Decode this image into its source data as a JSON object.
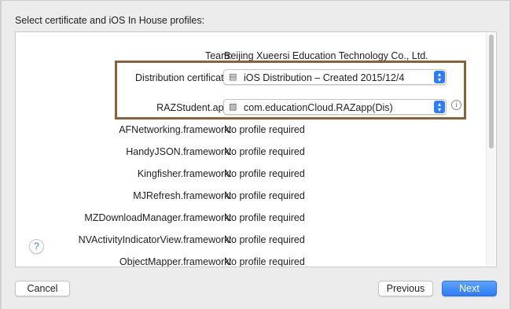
{
  "dialog": {
    "header": "Select certificate and iOS In House profiles:"
  },
  "rows": [
    {
      "label": "Team:",
      "value": "Beijing Xueersi Education Technology Co., Ltd."
    },
    {
      "label": "Distribution certificate:",
      "value": "iOS Distribution – Created 2015/12/4",
      "icon": "certificate-icon"
    },
    {
      "label": "RAZStudent.app:",
      "value": "com.educationCloud.RAZapp(Dis)",
      "icon": "profile-icon"
    },
    {
      "label": "AFNetworking.framework:",
      "value": "No profile required"
    },
    {
      "label": "HandyJSON.framework:",
      "value": "No profile required"
    },
    {
      "label": "Kingfisher.framework:",
      "value": "No profile required"
    },
    {
      "label": "MJRefresh.framework:",
      "value": "No profile required"
    },
    {
      "label": "MZDownloadManager.framework:",
      "value": "No profile required"
    },
    {
      "label": "NVActivityIndicatorView.framework:",
      "value": "No profile required"
    },
    {
      "label": "ObjectMapper.framework:",
      "value": "No profile required"
    }
  ],
  "icons": {
    "info": "i",
    "help": "?",
    "stepper_up": "▴",
    "stepper_down": "▾",
    "certificate": "▤",
    "profile": "▧"
  },
  "buttons": {
    "cancel": "Cancel",
    "previous": "Previous",
    "next": "Next"
  },
  "colors": {
    "highlight": "#8b6237",
    "accent": "#2e7cf6"
  }
}
